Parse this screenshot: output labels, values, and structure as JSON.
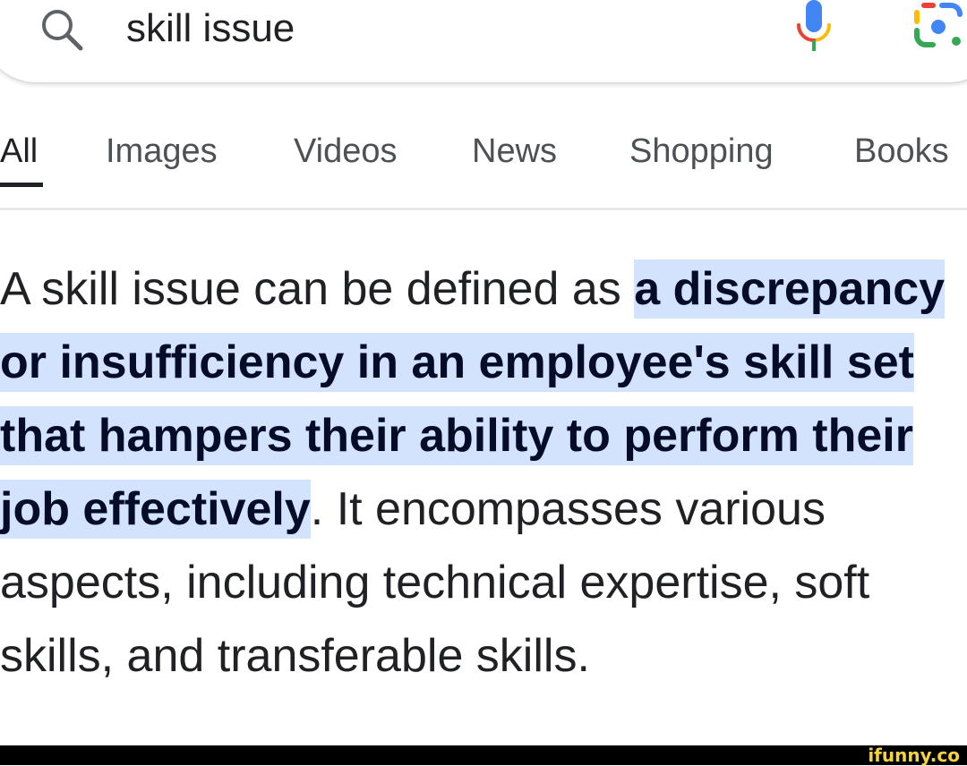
{
  "search": {
    "query": "skill issue",
    "icons": [
      "search-icon",
      "mic-icon",
      "google-lens-icon"
    ]
  },
  "tabs": [
    {
      "label": "All",
      "active": true
    },
    {
      "label": "Images",
      "active": false
    },
    {
      "label": "Videos",
      "active": false
    },
    {
      "label": "News",
      "active": false
    },
    {
      "label": "Shopping",
      "active": false
    },
    {
      "label": "Books",
      "active": false
    }
  ],
  "answer": {
    "prefix": "A skill issue can be defined as ",
    "highlight": "a discrepancy or insufficiency in an employee's skill set that hampers their ability to perform their job effectively",
    "suffix": ". It encompasses various aspects, including technical expertise, soft skills, and transferable skills."
  },
  "watermark": "ifunny.co",
  "colors": {
    "highlight_bg": "#d3e3fd",
    "text": "#202124",
    "tab_inactive": "#4d5156",
    "google_blue": "#4285F4",
    "google_red": "#EA4335",
    "google_yellow": "#FBBC05",
    "google_green": "#34A853"
  }
}
